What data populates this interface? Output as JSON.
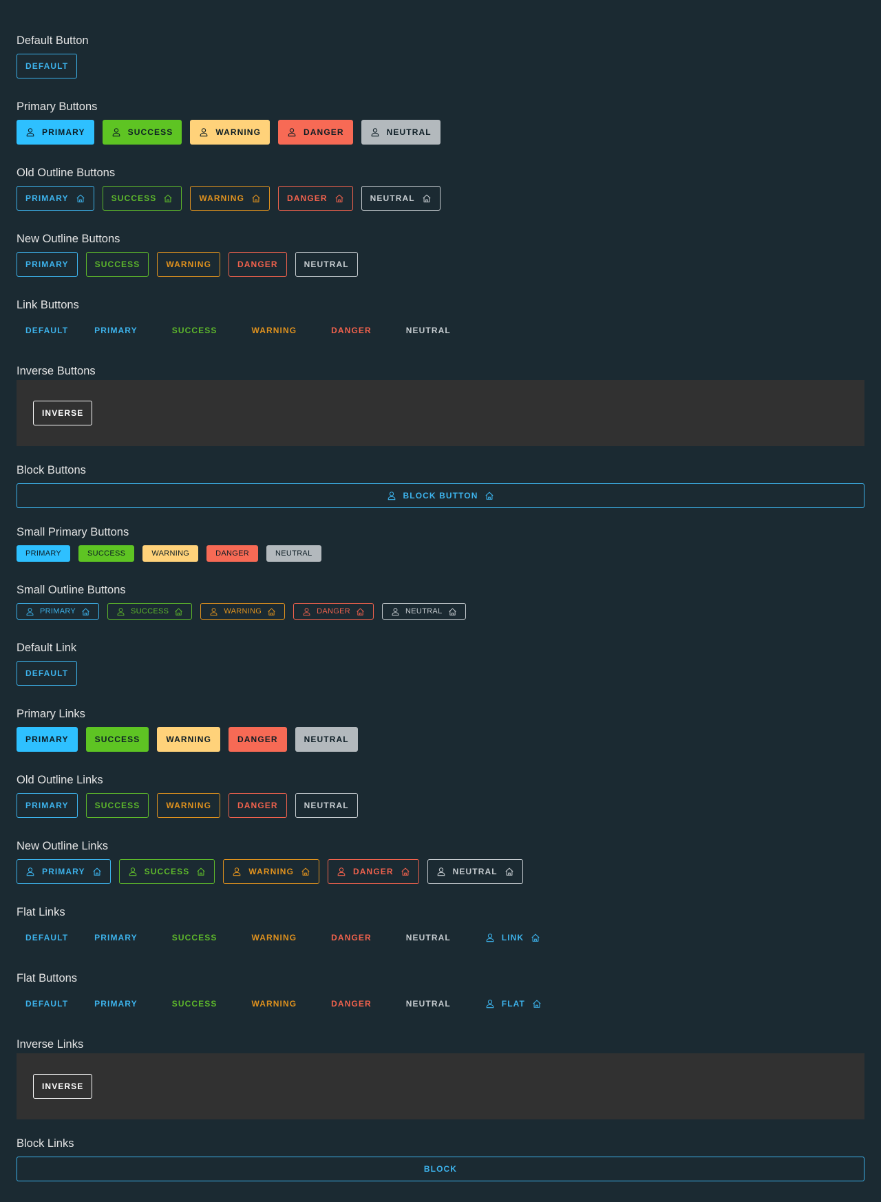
{
  "sections": {
    "default_button": {
      "title": "Default Button",
      "buttons": [
        "DEFAULT"
      ]
    },
    "primary_buttons": {
      "title": "Primary Buttons",
      "buttons": [
        "PRIMARY",
        "SUCCESS",
        "WARNING",
        "DANGER",
        "NEUTRAL"
      ]
    },
    "old_outline_buttons": {
      "title": "Old Outline Buttons",
      "buttons": [
        "PRIMARY",
        "SUCCESS",
        "WARNING",
        "DANGER",
        "NEUTRAL"
      ]
    },
    "new_outline_buttons": {
      "title": "New Outline Buttons",
      "buttons": [
        "PRIMARY",
        "SUCCESS",
        "WARNING",
        "DANGER",
        "NEUTRAL"
      ]
    },
    "link_buttons": {
      "title": "Link Buttons",
      "buttons": [
        "DEFAULT",
        "PRIMARY",
        "SUCCESS",
        "WARNING",
        "DANGER",
        "NEUTRAL"
      ]
    },
    "inverse_buttons": {
      "title": "Inverse Buttons",
      "buttons": [
        "INVERSE"
      ]
    },
    "block_buttons": {
      "title": "Block Buttons",
      "buttons": [
        "BLOCK BUTTON"
      ]
    },
    "small_primary_buttons": {
      "title": "Small Primary Buttons",
      "buttons": [
        "PRIMARY",
        "SUCCESS",
        "WARNING",
        "DANGER",
        "NEUTRAL"
      ]
    },
    "small_outline_buttons": {
      "title": "Small Outline Buttons",
      "buttons": [
        "PRIMARY",
        "SUCCESS",
        "WARNING",
        "DANGER",
        "NEUTRAL"
      ]
    },
    "default_link": {
      "title": "Default Link",
      "buttons": [
        "DEFAULT"
      ]
    },
    "primary_links": {
      "title": "Primary Links",
      "buttons": [
        "PRIMARY",
        "SUCCESS",
        "WARNING",
        "DANGER",
        "NEUTRAL"
      ]
    },
    "old_outline_links": {
      "title": "Old Outline Links",
      "buttons": [
        "PRIMARY",
        "SUCCESS",
        "WARNING",
        "DANGER",
        "NEUTRAL"
      ]
    },
    "new_outline_links": {
      "title": "New Outline Links",
      "buttons": [
        "PRIMARY",
        "SUCCESS",
        "WARNING",
        "DANGER",
        "NEUTRAL"
      ]
    },
    "flat_links": {
      "title": "Flat Links",
      "buttons": [
        "DEFAULT",
        "PRIMARY",
        "SUCCESS",
        "WARNING",
        "DANGER",
        "NEUTRAL",
        "LINK"
      ]
    },
    "flat_buttons": {
      "title": "Flat Buttons",
      "buttons": [
        "DEFAULT",
        "PRIMARY",
        "SUCCESS",
        "WARNING",
        "DANGER",
        "NEUTRAL",
        "FLAT"
      ]
    },
    "inverse_links": {
      "title": "Inverse Links",
      "buttons": [
        "INVERSE"
      ]
    },
    "block_links": {
      "title": "Block Links",
      "buttons": [
        "BLOCK"
      ]
    }
  },
  "colors": {
    "background": "#1b2a32",
    "primary": "#2ec0ff",
    "success": "#5ec423",
    "warning": "#ffd27a",
    "danger": "#f76a55",
    "neutral": "#b3b9bd",
    "inverse_panel": "#313131"
  },
  "icons": {
    "leading": "user-icon",
    "trailing": "home-icon"
  }
}
